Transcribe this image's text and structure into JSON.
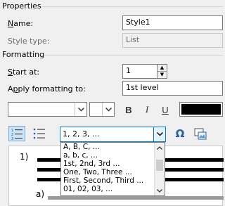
{
  "properties": {
    "section_title": "Properties",
    "name_label_u": "N",
    "name_label_rest": "ame:",
    "name_value": "Style1",
    "style_type_label": "Style type:",
    "style_type_value": "List"
  },
  "formatting": {
    "section_title": "Formatting",
    "start_at_label_u": "S",
    "start_at_label_rest": "tart at:",
    "start_at_value": "1",
    "apply_label_prefix": "A",
    "apply_label_u": "p",
    "apply_label_rest": "ply formatting to:",
    "apply_value": "1st level",
    "font_name": "",
    "font_size": "",
    "bold": "B",
    "italic": "I",
    "underline": "U",
    "font_color": "#000000"
  },
  "numbering": {
    "selected_style": "1, 2, 3, ...",
    "symbol_glyph": "Ω",
    "options": [
      "A, B, C, ...",
      "a, b, c, ...",
      "1st, 2nd, 3rd ...",
      "One, Two, Three ...",
      "First, Second, Third ...",
      "01, 02, 03, ..."
    ]
  },
  "preview": {
    "level1_label": "1)",
    "level2_label": "a)"
  }
}
